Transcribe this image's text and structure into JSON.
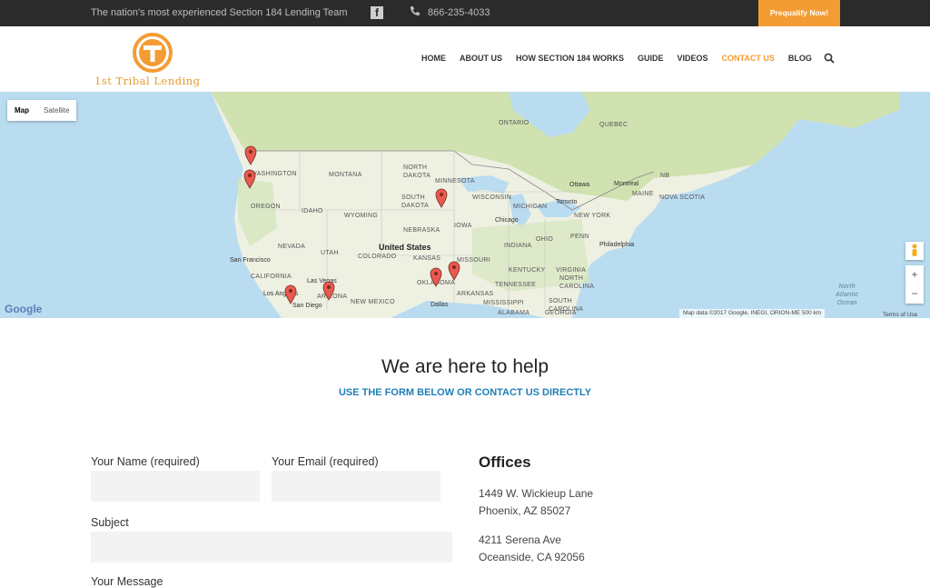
{
  "topbar": {
    "tagline": "The nation's most experienced Section 184 Lending Team",
    "phone": "866-235-4033",
    "prequalify": "Prequalify Now!"
  },
  "logo": {
    "text": "1st Tribal Lending"
  },
  "nav": [
    "HOME",
    "ABOUT US",
    "HOW SECTION 184 WORKS",
    "GUIDE",
    "VIDEOS",
    "CONTACT US",
    "BLOG"
  ],
  "nav_active": "CONTACT US",
  "map": {
    "types": [
      "Map",
      "Satellite"
    ],
    "selected_type": "Map",
    "zoom_in": "+",
    "zoom_out": "−",
    "google": "Google",
    "attribution": "Map data ©2017 Google, INEGI, ORION-ME    500 km",
    "terms": "Terms of Use",
    "labels": {
      "ontario": "ONTARIO",
      "quebec": "QUEBEC",
      "washington": "WASHINGTON",
      "montana": "MONTANA",
      "north_dakota": "NORTH\nDAKOTA",
      "minnesota": "MINNESOTA",
      "ottawa": "Ottawa",
      "montreal": "Montreal",
      "nb": "NB",
      "maine": "MAINE",
      "nova_scotia": "NOVA SCOTIA",
      "toronto": "Toronto",
      "oregon": "OREGON",
      "idaho": "IDAHO",
      "south_dakota": "SOUTH\nDAKOTA",
      "wisconsin": "WISCONSIN",
      "michigan": "MICHIGAN",
      "wyoming": "WYOMING",
      "iowa": "IOWA",
      "chicago": "Chicago",
      "new_york": "NEW YORK",
      "nebraska": "NEBRASKA",
      "nevada": "NEVADA",
      "utah": "UTAH",
      "united_states": "United States",
      "ohio": "OHIO",
      "penn": "PENN",
      "indiana": "INDIANA",
      "philadelphia": "Philadelphia",
      "colorado": "COLORADO",
      "kansas": "KANSAS",
      "missouri": "MISSOURI",
      "san_francisco": "San Francisco",
      "virginia": "VIRGINIA",
      "kentucky": "KENTUCKY",
      "california": "CALIFORNIA",
      "las_vegas": "Las Vegas",
      "oklahoma": "OKLAHOMA",
      "tennessee": "TENNESSEE",
      "north_carolina": "NORTH\nCAROLINA",
      "los_angeles": "Los Angeles",
      "arizona": "ARIZONA",
      "arkansas": "ARKANSAS",
      "south_carolina": "SOUTH\nCAROLINA",
      "san_diego": "San Diego",
      "new_mexico": "NEW MEXICO",
      "mississippi": "MISSISSIPPI",
      "dallas": "Dallas",
      "alabama": "ALABAMA",
      "georgia": "GEORGIA",
      "atlantic": "North\nAtlantic\nOcean"
    }
  },
  "help": {
    "title": "We are here to help",
    "subtitle": "USE THE FORM BELOW OR CONTACT US DIRECTLY"
  },
  "form": {
    "name_label": "Your Name (required)",
    "email_label": "Your Email (required)",
    "subject_label": "Subject",
    "message_label": "Your Message"
  },
  "offices": {
    "title": "Offices",
    "list": [
      {
        "line1": "1449 W. Wickieup Lane",
        "line2": "Phoenix, AZ 85027"
      },
      {
        "line1": "4211 Serena Ave",
        "line2": "Oceanside, CA 92056"
      }
    ]
  },
  "colors": {
    "accent": "#f39c34",
    "link": "#1f7fb8",
    "topbar": "#2b2b2b"
  }
}
